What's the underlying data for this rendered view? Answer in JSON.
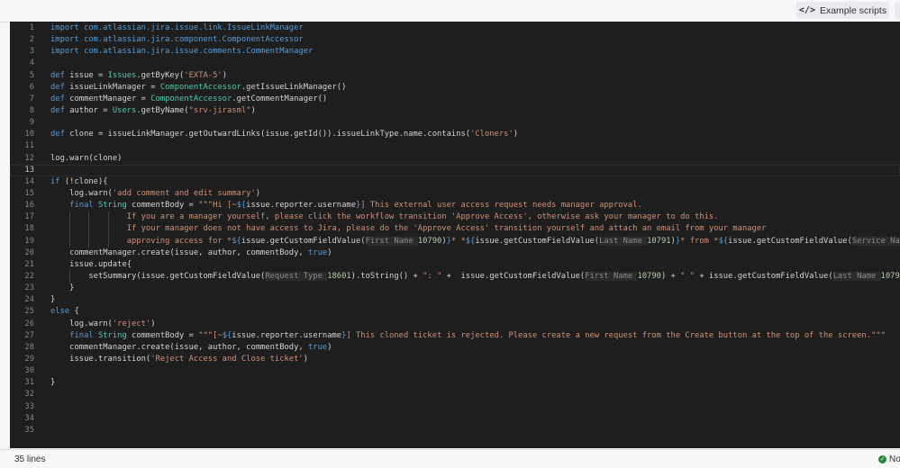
{
  "toolbar": {
    "example_scripts_label": "Example scripts",
    "example_scripts_icon": "code-icon"
  },
  "status": {
    "lines_label": "35 lines",
    "validation_label": "No"
  },
  "editor": {
    "current_line": 13,
    "lines": [
      [
        [
          "import com.atlassian.jira.issue.link.IssueLinkManager",
          "kw"
        ]
      ],
      [
        [
          "import com.atlassian.jira.component.ComponentAccessor",
          "kw"
        ]
      ],
      [
        [
          "import com.atlassian.jira.issue.comments.CommentManager",
          "kw"
        ]
      ],
      [],
      [
        [
          "def ",
          "kw"
        ],
        [
          "issue = "
        ],
        [
          "Issues",
          "cls"
        ],
        [
          ".getByKey("
        ],
        [
          "'EXTA-5'",
          "str"
        ],
        [
          ")"
        ]
      ],
      [
        [
          "def ",
          "kw"
        ],
        [
          "issueLinkManager = "
        ],
        [
          "ComponentAccessor",
          "cls"
        ],
        [
          ".getIssueLinkManager()"
        ]
      ],
      [
        [
          "def ",
          "kw"
        ],
        [
          "commentManager = "
        ],
        [
          "ComponentAccessor",
          "cls"
        ],
        [
          ".getCommentManager()"
        ]
      ],
      [
        [
          "def ",
          "kw"
        ],
        [
          "author = "
        ],
        [
          "Users",
          "cls"
        ],
        [
          ".getByName("
        ],
        [
          "\"srv-jirasml\"",
          "str"
        ],
        [
          ")"
        ]
      ],
      [],
      [
        [
          "def ",
          "kw"
        ],
        [
          "clone = issueLinkManager.getOutwardLinks(issue.getId()).issueLinkType.name.contains("
        ],
        [
          "'Cloners'",
          "str"
        ],
        [
          ")"
        ]
      ],
      [],
      [
        [
          "log.warn(clone)"
        ]
      ],
      [],
      [
        [
          "if ",
          "kw"
        ],
        [
          "(!clone){"
        ]
      ],
      [
        [
          "    log.warn("
        ],
        [
          "'add comment and edit summary'",
          "str"
        ],
        [
          ")"
        ]
      ],
      [
        [
          "    "
        ],
        [
          "final ",
          "kw"
        ],
        [
          "String ",
          "cls"
        ],
        [
          "commentBody = "
        ],
        [
          "\"\"\"Hi [~",
          "str"
        ],
        [
          "${",
          "kw"
        ],
        [
          "issue.reporter.username"
        ],
        [
          "}",
          "kw"
        ],
        [
          "] This external user access request needs manager approval.",
          "str"
        ]
      ],
      [
        [
          "                If you are a manager yourself, please click the workflow transition 'Approve Access', otherwise ask your manager to do this.",
          "str"
        ]
      ],
      [
        [
          "                If your manager does not have access to Jira, please do the 'Approve Access' transition yourself and attach an email from your manager",
          "str"
        ]
      ],
      [
        [
          "                approving access for *",
          "str"
        ],
        [
          "${",
          "kw"
        ],
        [
          "issue.getCustomFieldValue("
        ],
        [
          "First Name ",
          "hint"
        ],
        [
          "10790",
          "num"
        ],
        [
          ")"
        ],
        [
          "}",
          "kw"
        ],
        [
          "* *",
          "str"
        ],
        [
          "${",
          "kw"
        ],
        [
          "issue.getCustomFieldValue("
        ],
        [
          "Last Name ",
          "hint"
        ],
        [
          "10791",
          "num"
        ],
        [
          ")"
        ],
        [
          "}",
          "kw"
        ],
        [
          "* from *",
          "str"
        ],
        [
          "${",
          "kw"
        ],
        [
          "issue.getCustomFieldValue("
        ],
        [
          "Service Na",
          "hint"
        ]
      ],
      [
        [
          "    commentManager.create(issue, author, commentBody, "
        ],
        [
          "true",
          "kw"
        ],
        [
          ")"
        ]
      ],
      [
        [
          "    issue.update{"
        ]
      ],
      [
        [
          "        setSummary(issue.getCustomFieldValue("
        ],
        [
          "Request Type ",
          "hint"
        ],
        [
          "18601",
          "num"
        ],
        [
          ").toString() + "
        ],
        [
          "\": \"",
          "str"
        ],
        [
          " +  issue.getCustomFieldValue("
        ],
        [
          "First Name ",
          "hint"
        ],
        [
          "10790",
          "num"
        ],
        [
          ") + "
        ],
        [
          "\" \"",
          "str"
        ],
        [
          " + issue.getCustomFieldValue("
        ],
        [
          "Last Name ",
          "hint"
        ],
        [
          "1079",
          "num"
        ]
      ],
      [
        [
          "    }"
        ]
      ],
      [
        [
          "}"
        ]
      ],
      [
        [
          "else ",
          "kw"
        ],
        [
          "{"
        ]
      ],
      [
        [
          "    log.warn("
        ],
        [
          "'reject'",
          "str"
        ],
        [
          ")"
        ]
      ],
      [
        [
          "    "
        ],
        [
          "final ",
          "kw"
        ],
        [
          "String ",
          "cls"
        ],
        [
          "commentBody = "
        ],
        [
          "\"\"\"[~",
          "str"
        ],
        [
          "${",
          "kw"
        ],
        [
          "issue.reporter.username"
        ],
        [
          "}",
          "kw"
        ],
        [
          "] This cloned ticket is rejected. Please create a new request from the Create button at the top of the screen.\"\"\"",
          "str"
        ]
      ],
      [
        [
          "    commentManager.create(issue, author, commentBody, "
        ],
        [
          "true",
          "kw"
        ],
        [
          ")"
        ]
      ],
      [
        [
          "    issue.transition("
        ],
        [
          "'Reject Access and Close ticket'",
          "str"
        ],
        [
          ")"
        ]
      ],
      [],
      [
        [
          "}"
        ]
      ],
      [],
      [],
      [],
      []
    ]
  }
}
